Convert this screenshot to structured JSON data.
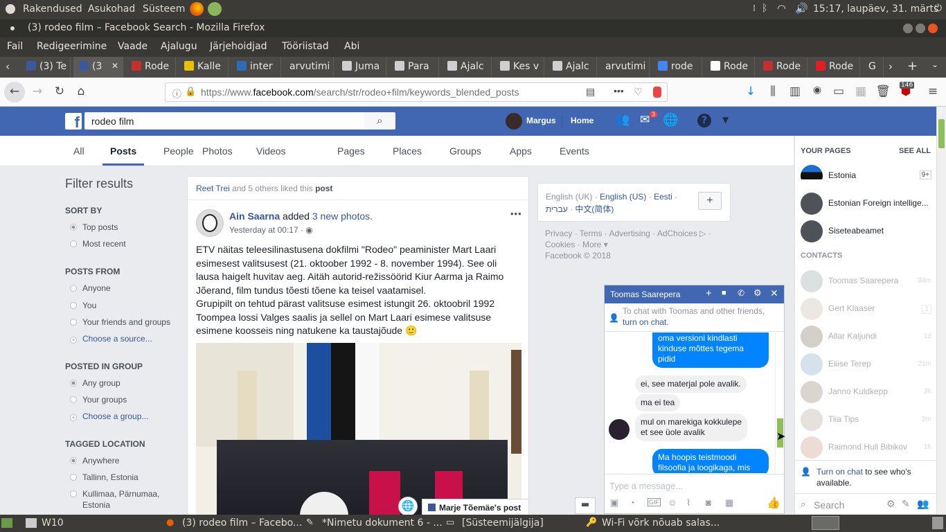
{
  "system_bar": {
    "apps": "Rakendused",
    "places": "Asukohad",
    "system": "Süsteem",
    "clock": "15:17, laupäev, 31. märts"
  },
  "window": {
    "title": "(3) rodeo film – Facebook Search - Mozilla Firefox"
  },
  "menu": {
    "file": "Fail",
    "edit": "Redigeerimine",
    "view": "Vaade",
    "history": "Ajalugu",
    "bookmarks": "Järjehoidjad",
    "tools": "Tööriistad",
    "help": "Abi"
  },
  "tabs": [
    {
      "label": "(3) Te",
      "icon": "facebook-icon",
      "color": "#3b5998"
    },
    {
      "label": "(3",
      "icon": "facebook-icon",
      "color": "#3b5998"
    },
    {
      "label": "Rode",
      "icon": "imdb-icon",
      "color": "#c4302b"
    },
    {
      "label": "Kalle",
      "icon": "page-icon",
      "color": "#e6c200"
    },
    {
      "label": "inter",
      "icon": "page-icon",
      "color": "#2a6ebb"
    },
    {
      "label": "arvutimi",
      "icon": "",
      "color": ""
    },
    {
      "label": "Juma",
      "icon": "page-icon",
      "color": "#cfcfcf"
    },
    {
      "label": "Para",
      "icon": "page-icon",
      "color": "#cfcfcf"
    },
    {
      "label": "Ajalc",
      "icon": "page-icon",
      "color": "#cfcfcf"
    },
    {
      "label": "Kes v",
      "icon": "page-icon",
      "color": "#cfcfcf"
    },
    {
      "label": "Ajalc",
      "icon": "page-icon",
      "color": "#cfcfcf"
    },
    {
      "label": "arvutimi",
      "icon": "",
      "color": ""
    },
    {
      "label": "rode",
      "icon": "google-icon",
      "color": "#4285f4"
    },
    {
      "label": "Rode",
      "icon": "wikipedia-icon",
      "color": "#ffffff"
    },
    {
      "label": "Rode",
      "icon": "imdb-icon",
      "color": "#c4302b"
    },
    {
      "label": "Rode",
      "icon": "page-icon",
      "color": "#e02020"
    },
    {
      "label": "G",
      "icon": "",
      "color": ""
    }
  ],
  "url": {
    "prefix": "https://www.",
    "domain": "facebook.com",
    "path": "/search/str/rodeo+film/keywords_blended_posts"
  },
  "toolbar": {
    "badge": "146"
  },
  "fb": {
    "search_value": "rodeo film",
    "user": "Margus",
    "home": "Home",
    "messages_badge": "3"
  },
  "search_tabs": [
    "All",
    "Posts",
    "People",
    "Photos",
    "Videos",
    "Pages",
    "Places",
    "Groups",
    "Apps",
    "Events"
  ],
  "filters": {
    "title": "Filter results",
    "sort_by": "SORT BY",
    "top_posts": "Top posts",
    "most_recent": "Most recent",
    "posts_from": "POSTS FROM",
    "anyone": "Anyone",
    "you": "You",
    "friends_groups": "Your friends and groups",
    "choose_source": "Choose a source...",
    "posted_in_group": "POSTED IN GROUP",
    "any_group": "Any group",
    "your_groups": "Your groups",
    "choose_group": "Choose a group...",
    "tagged_location": "TAGGED LOCATION",
    "anywhere": "Anywhere",
    "tallinn": "Tallinn, Estonia",
    "kullimaa_1": "Kullimaa, Pärnumaa,",
    "kullimaa_2": "Estonia"
  },
  "post": {
    "liked_name": "Reet Trei",
    "liked_rest": " and 5 others liked this ",
    "liked_link": "post",
    "author": "Ain Saarna",
    "action": " added ",
    "action_link": "3 new photos.",
    "time": "Yesterday at 00:17 · ",
    "lines": [
      "ETV näitas teleesilinastusena dokfilmi \"Rodeo\" peaminister Mart Laari",
      "esimesest valitsusest (21. oktoober 1992 - 8. november 1994). See oli",
      "lausa haigelt huvitav aeg. Aitäh autorid-režissöörid Kiur Aarma ja Raimo",
      "Jõerand, film tundus tõesti tõene ka teisel vaatamisel.",
      "Grupipilt on tehtud pärast valitsuse esimest istungit 26. oktoobril 1992",
      "Toompea lossi Valges saalis ja sellel on Mart Laari esimese valitsuse",
      "esimene koosseis ning natukene ka taustajõude 🙂"
    ],
    "share_label": "Marje Tõemäe's post"
  },
  "languages": {
    "current": "English (UK) · ",
    "l1": "English (US)",
    "sep": " · ",
    "l2": "Eesti",
    "l3": "עברית",
    "l4": "中文(简体)"
  },
  "footer": {
    "line1": "Privacy · Terms · Advertising · AdChoices ▷ ·",
    "line2": "Cookies · More ▾",
    "line3": "Facebook © 2018"
  },
  "sidebar": {
    "your_pages": "YOUR PAGES",
    "see_all": "SEE ALL",
    "pages": [
      {
        "name": "Estonia",
        "badge": "9+"
      },
      {
        "name": "Estonian Foreign intellige...",
        "badge": ""
      },
      {
        "name": "Siseteabeamet",
        "badge": ""
      }
    ],
    "contacts_title": "CONTACTS",
    "contacts": [
      {
        "name": "Toomas Saarepera",
        "time": "34m"
      },
      {
        "name": "Gert Klaaser",
        "time": "1"
      },
      {
        "name": "Allar Kaljundi",
        "time": "1d"
      },
      {
        "name": "Eliise Terep",
        "time": "21m"
      },
      {
        "name": "Janno Kuldkepp",
        "time": "2h"
      },
      {
        "name": "Tiia Tips",
        "time": "2m"
      },
      {
        "name": "Raimond Hull Bibikov",
        "time": "1h"
      }
    ],
    "turn_on_link": "Turn on chat",
    "turn_on_rest": " to see who's",
    "turn_on_rest2": "available.",
    "search_placeholder": "Search"
  },
  "chat": {
    "name": "Toomas Saarepera",
    "notice_1": "To chat with Toomas and other friends,",
    "notice_link": "turn on chat.",
    "m1": [
      "oma versioni kindlasti",
      "kinduse mõttes tegema",
      "pidid"
    ],
    "m2": "ei, see materjal pole avalik.",
    "m3": "ma ei tea",
    "m4": [
      "mul on marekiga kokkulepe",
      "et see üole avalik"
    ],
    "m5": [
      "Ma hoopis teistmoodi",
      "filsoofia ja loogikaga, mis"
    ],
    "input_placeholder": "Type a message..."
  },
  "taskbar": {
    "workspace": "W10",
    "t1": "(3) rodeo film – Facebo...",
    "t2": "*Nimetu dokument 6 - ...",
    "t3": "[Süsteemijälgija]",
    "t4": "Wi-Fi võrk nõuab salas..."
  }
}
